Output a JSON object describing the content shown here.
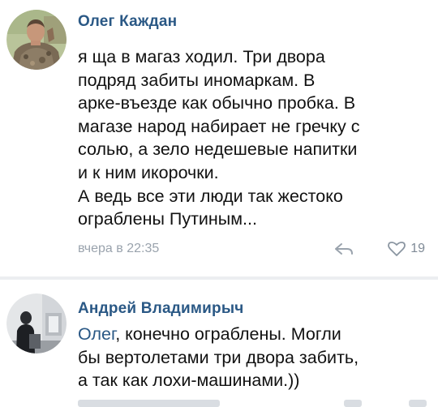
{
  "comments": [
    {
      "author": "Олег Каждан",
      "avatar": "user-photo-olegkazhdan",
      "lines": [
        "я ща в магаз ходил. Три двора",
        "подряд забиты иномаркам. В",
        "арке-въезде как обычно пробка. В",
        "магазе народ набирает не гречку с",
        "солью, а зело недешевые напитки",
        "и к ним икорочки.",
        "А ведь все эти люди так жестоко",
        "ограблены Путиным..."
      ],
      "timestamp": "вчера в 22:35",
      "reply_icon": "reply-arrow-icon",
      "like_icon": "heart-icon",
      "likes": "19"
    },
    {
      "author": "Андрей Владимирыч",
      "avatar": "user-photo-andrei",
      "mention": "Олег",
      "lines": [
        ", конечно ограблены. Могли",
        "бы вертолетами три двора забить,",
        "а так как лохи-машинами.))"
      ]
    }
  ],
  "colors": {
    "link": "#2a5885",
    "text": "#111111",
    "meta": "#9aa3ad",
    "separator": "#eceef1",
    "background": "#ffffff"
  }
}
